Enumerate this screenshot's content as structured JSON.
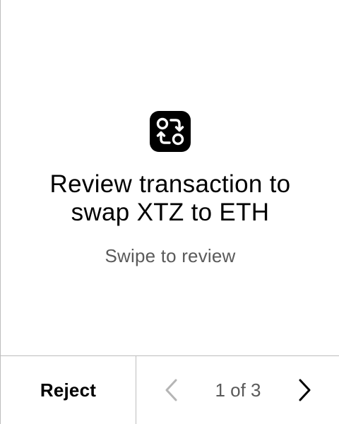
{
  "review": {
    "icon": "swap-arrows-icon",
    "title_line1": "Review transaction to",
    "title_line2": "swap XTZ to ETH",
    "subtitle": "Swipe to review"
  },
  "footer": {
    "reject_label": "Reject",
    "page_indicator": "1 of 3",
    "prev_icon": "chevron-left-icon",
    "next_icon": "chevron-right-icon"
  },
  "colors": {
    "text": "#000000",
    "muted_text": "#5a5a5a",
    "disabled_icon": "#b5b5b5",
    "divider": "#bdbdbd",
    "icon_background": "#000000"
  }
}
